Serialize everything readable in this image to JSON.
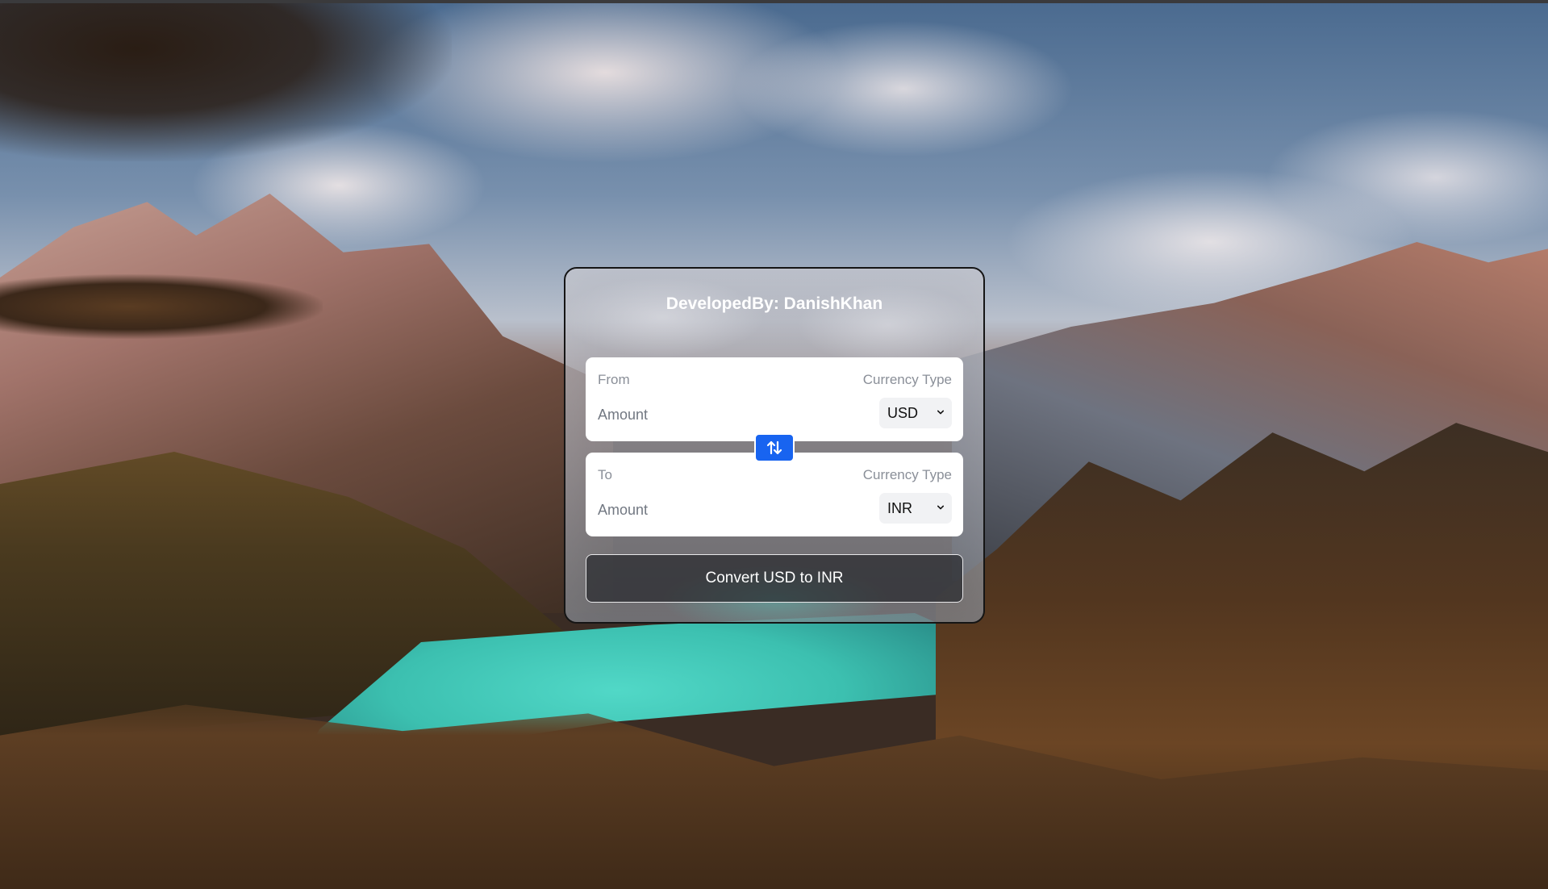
{
  "card": {
    "title": "DevelopedBy: DanishKhan"
  },
  "from": {
    "label": "From",
    "currency_label": "Currency Type",
    "amount_placeholder": "Amount",
    "currency": "USD"
  },
  "to": {
    "label": "To",
    "currency_label": "Currency Type",
    "amount_placeholder": "Amount",
    "currency": "INR"
  },
  "swap": {
    "icon": "swap-arrows-icon",
    "color": "#1864f0"
  },
  "convert": {
    "label": "Convert USD to INR"
  },
  "icons": {
    "select_chevron": "chevron-down-icon"
  }
}
